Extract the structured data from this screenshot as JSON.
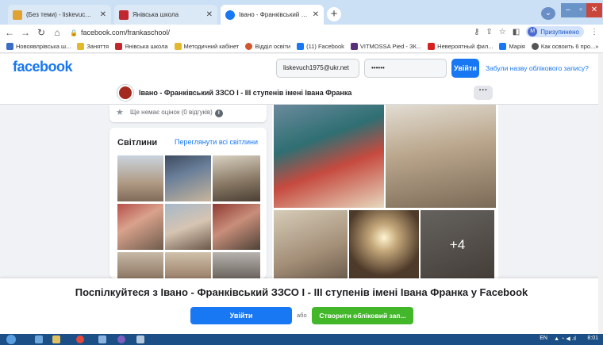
{
  "browser": {
    "tabs": [
      {
        "label": "(Без теми) - liskevuch1975@uk",
        "active": false
      },
      {
        "label": "Янівська школа",
        "active": false
      },
      {
        "label": "Івано - Франківський ЗЗСО І - ІІ",
        "active": true
      }
    ],
    "new_tab": "+",
    "url": "facebook.com/frankaschool/",
    "profile_letter": "M",
    "profile_status": "Призупинено",
    "bookmarks": [
      "Новоявлрівська ш...",
      "Заняття",
      "Янівська школа",
      "Методичний кабінет",
      "Відділ освіти",
      "(11) Facebook",
      "VITMOSSA Pied - ЗК...",
      "Невероятный фил...",
      "Марія",
      "Как освоить 6 про..."
    ],
    "bookmarks_more": "»"
  },
  "fb_header": {
    "logo": "facebook",
    "email_value": "liskevuch1975@ukr.net",
    "password_value": "••••••",
    "login_label": "Увійти",
    "forgot_label": "Забули назву облікового запису?"
  },
  "page": {
    "name": "Івано - Франківський ЗЗСО І - ІІІ ступенів імені Івана Франка",
    "more": "···",
    "rating_text": "Ще немає оцінок (0 відгуків)",
    "rating_info": "i",
    "photos_title": "Світлини",
    "photos_all": "Переглянути всі світлини",
    "more_photos": "+4"
  },
  "overlay": {
    "title": "Поспілкуйтеся з Івано - Франківський ЗЗСО І - ІІІ ступенів імені Івана Франка у Facebook",
    "login_label": "Увійти",
    "or_label": "або",
    "create_label": "Створити обліковий зап..."
  },
  "taskbar": {
    "lang": "EN",
    "time": "8:01"
  }
}
